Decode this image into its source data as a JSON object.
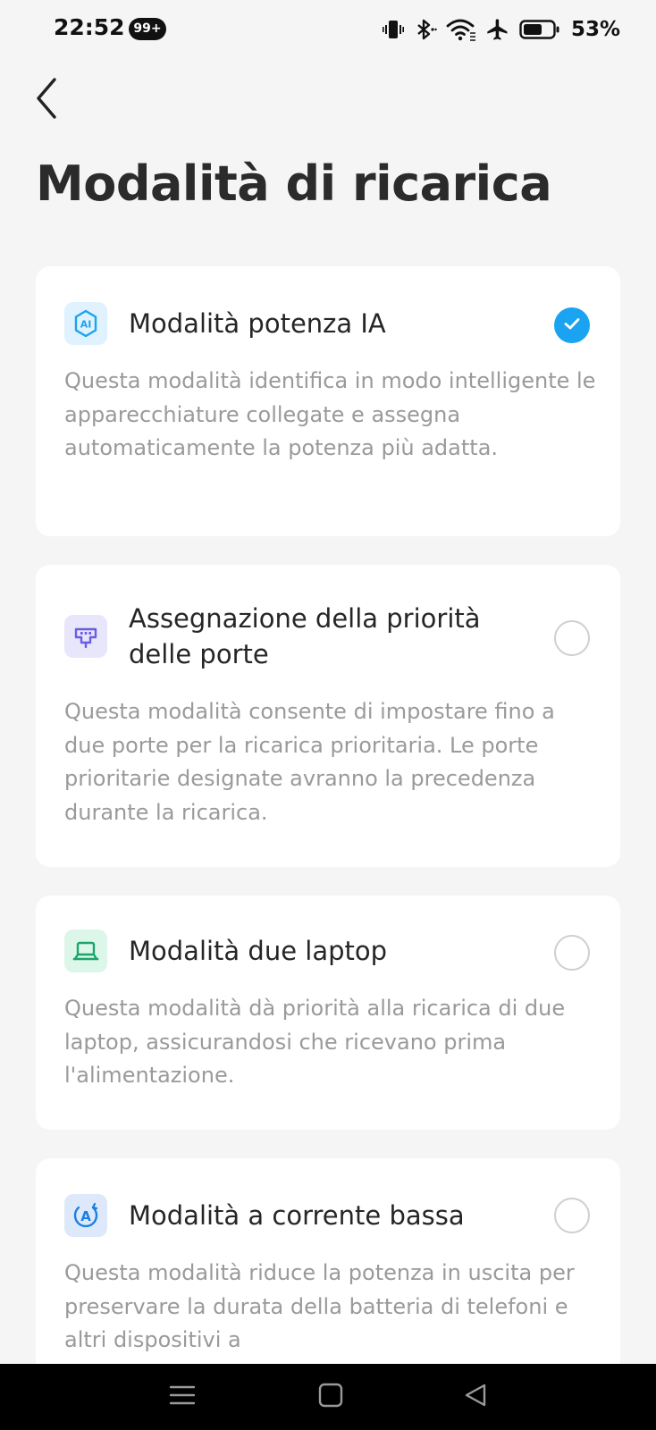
{
  "status_bar": {
    "time": "22:52",
    "notification_badge": "99+",
    "battery_percent": "53%",
    "icons": [
      "vibrate-icon",
      "bluetooth-icon",
      "wifi-icon",
      "airplane-icon",
      "battery-icon"
    ]
  },
  "header": {
    "back_icon": "chevron-left-icon",
    "title": "Modalità di ricarica"
  },
  "modes": [
    {
      "title": "Modalità potenza IA",
      "description": "Questa modalità identifica in modo intelligente le apparecchiature collegate e assegna automaticamente la potenza più adatta.",
      "selected": true,
      "icon": "ai-icon",
      "icon_label": "AI",
      "icon_color": "#1aa3f0"
    },
    {
      "title": "Assegnazione della priorità delle porte",
      "description": "Questa modalità consente di impostare fino a due porte per la ricarica prioritaria. Le porte prioritarie designate avranno la precedenza durante la ricarica.",
      "selected": false,
      "icon": "port-priority-icon",
      "icon_color": "#6b5ce7"
    },
    {
      "title": "Modalità due laptop",
      "description": "Questa modalità dà priorità alla ricarica di due laptop, assicurandosi che ricevano prima l'alimentazione.",
      "selected": false,
      "icon": "laptop-icon",
      "icon_color": "#1aa56a"
    },
    {
      "title": "Modalità a corrente bassa",
      "description": "Questa modalità riduce la potenza in uscita per preservare la durata della batteria di telefoni e altri dispositivi a",
      "selected": false,
      "icon": "low-current-icon",
      "icon_label": "A",
      "icon_color": "#1a7fe0"
    }
  ],
  "nav_bar": {
    "buttons": [
      "menu-icon",
      "home-icon",
      "back-triangle-icon"
    ]
  },
  "colors": {
    "accent": "#1aa3f0",
    "background": "#f5f5f5",
    "card": "#ffffff",
    "description_text": "#9a9a9a"
  }
}
